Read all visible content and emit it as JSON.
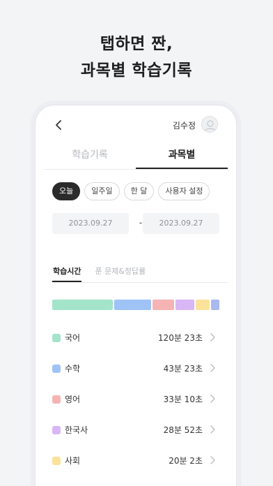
{
  "headline": {
    "line1": "탭하면 짠,",
    "line2": "과목별 학습기록"
  },
  "topbar": {
    "user_name": "김수정"
  },
  "tabs": [
    {
      "label": "학습기록",
      "active": false
    },
    {
      "label": "과목별",
      "active": true
    }
  ],
  "period_chips": [
    {
      "label": "오늘",
      "active": true
    },
    {
      "label": "일주일",
      "active": false
    },
    {
      "label": "한 달",
      "active": false
    },
    {
      "label": "사용자 설정",
      "active": false
    }
  ],
  "date_range": {
    "from": "2023.09.27",
    "separator": "-",
    "to": "2023.09.27"
  },
  "subtabs": [
    {
      "label": "학습시간",
      "active": true
    },
    {
      "label": "푼 문제&정답률",
      "active": false
    }
  ],
  "subjects": [
    {
      "name": "국어",
      "time": "120분 23초",
      "color": "#a3e4cb",
      "share": 0.405
    },
    {
      "name": "수학",
      "time": "43분 23초",
      "color": "#9fc3f7",
      "share": 0.245
    },
    {
      "name": "영어",
      "time": "33분 10초",
      "color": "#f6b3b3",
      "share": 0.14
    },
    {
      "name": "한국사",
      "time": "28분 52초",
      "color": "#d9b6f6",
      "share": 0.125
    },
    {
      "name": "사회",
      "time": "20분 2초",
      "color": "#fbe29a",
      "share": 0.095
    },
    {
      "name": "",
      "time": "",
      "color": "#aab9ee",
      "share": 0.055
    }
  ]
}
